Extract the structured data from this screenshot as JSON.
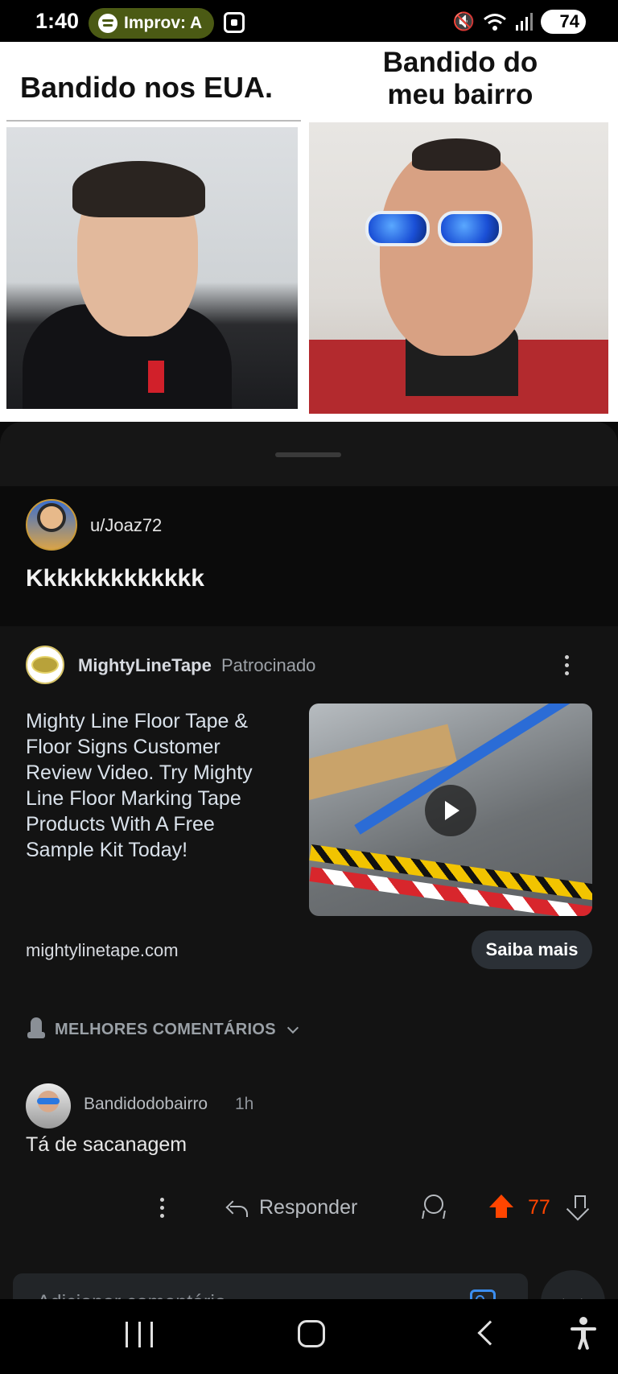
{
  "status_bar": {
    "time": "1:40",
    "media_app": "Improv: A",
    "battery": "74"
  },
  "meme": {
    "caption_left": "Bandido nos EUA.",
    "caption_right": "Bandido do meu bairro"
  },
  "post": {
    "username": "u/Joaz72",
    "title": "Kkkkkkkkkkkkk"
  },
  "ad": {
    "advertiser": "MightyLineTape",
    "sponsored_label": "Patrocinado",
    "headline": "Mighty Line Floor Tape & Floor Signs Customer Review Video. Try Mighty Line Floor Marking Tape Products With A Free Sample Kit Today!",
    "domain": "mightylinetape.com",
    "cta_label": "Saiba mais"
  },
  "comments": {
    "sort_label": "MELHORES COMENTÁRIOS",
    "items": [
      {
        "username": "Bandidodobairro",
        "time": "1h",
        "text": "Tá de sacanagem",
        "reply_label": "Responder",
        "votes": "77"
      }
    ]
  },
  "composer": {
    "placeholder": "Adicionar comentário"
  },
  "colors": {
    "upvote_accent": "#ff4500",
    "image_icon": "#3b8ef0",
    "spotify_pill": "#4b5a14"
  },
  "icons": [
    "spotify-icon",
    "screenshot-icon",
    "mute-icon",
    "wifi-icon",
    "signal-icon",
    "kebab-icon",
    "play-icon",
    "rocket-icon",
    "chevron-down-icon",
    "reply-icon",
    "award-icon",
    "upvote-icon",
    "downvote-icon",
    "image-icon",
    "collapse-icon",
    "recents-icon",
    "home-icon",
    "back-icon",
    "accessibility-icon"
  ]
}
